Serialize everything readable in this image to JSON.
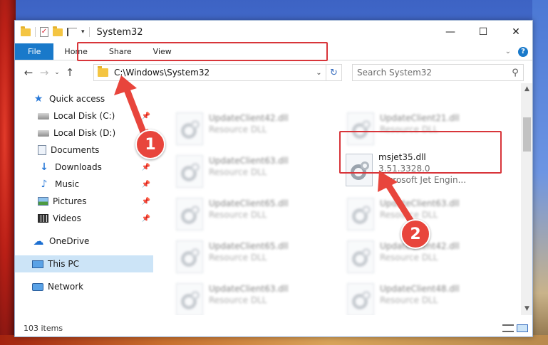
{
  "window": {
    "title": "System32",
    "controls": {
      "minimize": "—",
      "maximize": "☐",
      "close": "✕"
    }
  },
  "ribbon": {
    "tabs": [
      "File",
      "Home",
      "Share",
      "View"
    ],
    "collapse": "⌄",
    "help": "?"
  },
  "nav": {
    "back": "←",
    "forward": "→",
    "recent": "⌄",
    "up": "↑",
    "address": "C:\\Windows\\System32",
    "address_dropdown": "⌄",
    "refresh": "↻",
    "search_placeholder": "Search System32",
    "search_icon": "⚲"
  },
  "sidebar": {
    "items": [
      {
        "label": "Quick access",
        "icon": "star-icon",
        "pinned": false
      },
      {
        "label": "Local Disk (C:)",
        "icon": "drive-icon",
        "pinned": true
      },
      {
        "label": "Local Disk (D:)",
        "icon": "drive-icon",
        "pinned": true
      },
      {
        "label": "Documents",
        "icon": "document-icon",
        "pinned": true
      },
      {
        "label": "Downloads",
        "icon": "download-icon",
        "pinned": true
      },
      {
        "label": "Music",
        "icon": "music-icon",
        "pinned": true
      },
      {
        "label": "Pictures",
        "icon": "pictures-icon",
        "pinned": true
      },
      {
        "label": "Videos",
        "icon": "videos-icon",
        "pinned": true
      },
      {
        "label": "OneDrive",
        "icon": "cloud-icon",
        "pinned": false
      },
      {
        "label": "This PC",
        "icon": "computer-icon",
        "pinned": false,
        "selected": true
      },
      {
        "label": "Network",
        "icon": "network-icon",
        "pinned": false
      }
    ],
    "pin_glyph": "📌"
  },
  "files": [
    {
      "name": "UpdateClient42.dll",
      "sub": "Resource DLL",
      "blurred": true
    },
    {
      "name": "UpdateClient21.dll",
      "sub": "Resource DLL",
      "blurred": true
    },
    {
      "name": "UpdateClient63.dll",
      "sub": "Resource DLL",
      "blurred": true
    },
    {
      "name": "msjet35.dll",
      "sub": "3.51.3328.0",
      "sub2": "Microsoft Jet Engin...",
      "blurred": false
    },
    {
      "name": "UpdateClient65.dll",
      "sub": "Resource DLL",
      "blurred": true
    },
    {
      "name": "UpdateClient63.dll",
      "sub": "Resource DLL",
      "blurred": true
    },
    {
      "name": "UpdateClient65.dll",
      "sub": "Resource DLL",
      "blurred": true
    },
    {
      "name": "UpdateClient42.dll",
      "sub": "Resource DLL",
      "blurred": true
    },
    {
      "name": "UpdateClient63.dll",
      "sub": "Resource DLL",
      "blurred": true
    },
    {
      "name": "UpdateClient48.dll",
      "sub": "Resource DLL",
      "blurred": true
    }
  ],
  "status": {
    "item_count": "103 items"
  },
  "annotations": {
    "step1": "1",
    "step2": "2",
    "color": "#e8453c"
  },
  "colors": {
    "accent": "#1979ca",
    "highlight": "#d8353a",
    "selected": "#cce4f7"
  }
}
